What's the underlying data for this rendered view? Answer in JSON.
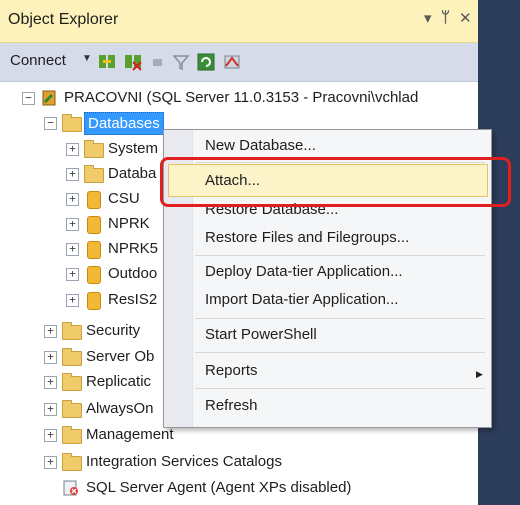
{
  "window": {
    "title": "Object Explorer",
    "controls": {
      "dropdown": "▾",
      "pin": "ᵖ",
      "close": "✕"
    }
  },
  "toolbar": {
    "connect_label": "Connect",
    "icons": [
      "connect-object-explorer-icon",
      "disconnect-icon",
      "stop-icon",
      "filter-icon",
      "refresh-icon",
      "activity-monitor-icon"
    ]
  },
  "tree": {
    "server": "PRACOVNI (SQL Server 11.0.3153 - Pracovni\\vchlad",
    "databases": "Databases",
    "db_children": [
      "System",
      "Databa",
      "CSU",
      "NPRK",
      "NPRK5",
      "Outdoo",
      "ResIS2"
    ],
    "server_children": [
      "Security",
      "Server Ob",
      "Replicatic",
      "AlwaysOn",
      "Management",
      "Integration Services Catalogs"
    ],
    "agent": "SQL Server Agent (Agent XPs disabled)"
  },
  "context_menu": {
    "items": [
      "New Database...",
      "Attach...",
      "Restore Database...",
      "Restore Files and Filegroups...",
      "Deploy Data-tier Application...",
      "Import Data-tier Application...",
      "Start PowerShell",
      "Reports",
      "Refresh"
    ],
    "highlighted": "Attach..."
  },
  "colors": {
    "accent": "#3399ff",
    "title_bar": "#fdf2bb",
    "highlight_box": "#e02020",
    "side_panel": "#2c3d5c"
  }
}
